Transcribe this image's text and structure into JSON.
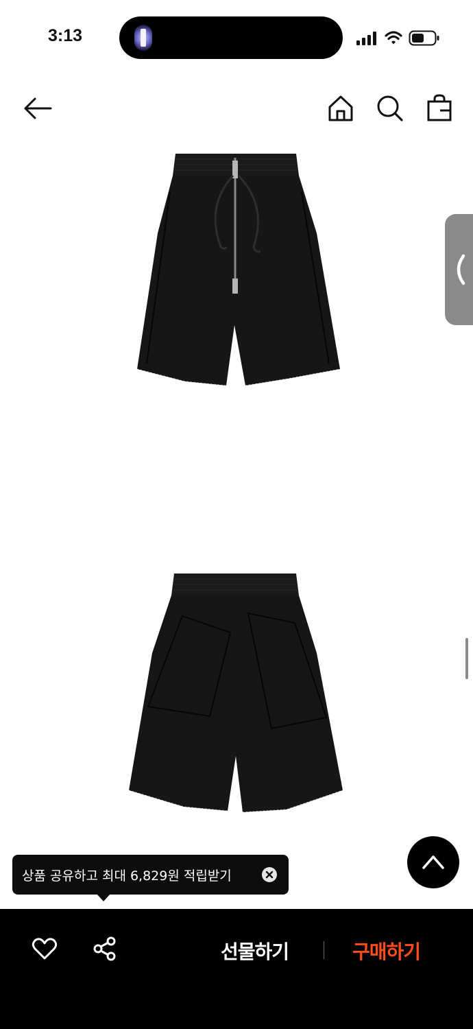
{
  "status_bar": {
    "time": "3:13",
    "icons": [
      "flashlight-icon",
      "signal-icon",
      "wifi-icon",
      "battery-icon"
    ]
  },
  "header": {
    "icons": [
      "back-arrow-icon",
      "home-icon",
      "search-icon",
      "shopping-bag-icon"
    ]
  },
  "product_images": [
    {
      "name": "front view of black shorts"
    },
    {
      "name": "back view of black shorts"
    }
  ],
  "tooltip": {
    "text": "상품 공유하고 최대 6,829원 적립받기"
  },
  "bottom_bar": {
    "gift_label": "선물하기",
    "buy_label": "구매하기",
    "buy_color": "#ff4d1a",
    "icons": [
      "heart-icon",
      "share-icon"
    ]
  }
}
